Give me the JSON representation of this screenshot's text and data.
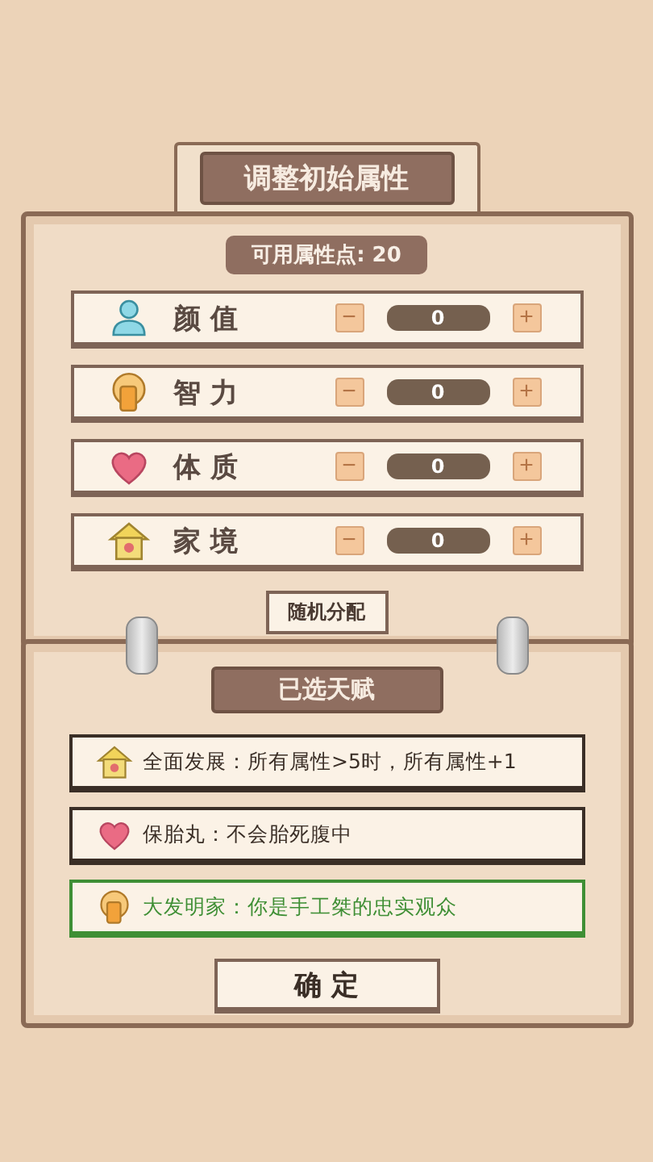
{
  "title": "调整初始属性",
  "points_label": "可用属性点: 20",
  "attributes": [
    {
      "kind": "person",
      "name": "颜 值",
      "minus": "−",
      "value": "0",
      "plus": "+"
    },
    {
      "kind": "brain",
      "name": "智 力",
      "minus": "−",
      "value": "0",
      "plus": "+"
    },
    {
      "kind": "heart",
      "name": "体 质",
      "minus": "−",
      "value": "0",
      "plus": "+"
    },
    {
      "kind": "house",
      "name": "家 境",
      "minus": "−",
      "value": "0",
      "plus": "+"
    }
  ],
  "random_button": "随机分配",
  "talents_title": "已选天赋",
  "talents": [
    {
      "kind": "house",
      "text": "全面发展：所有属性>5时，所有属性+1",
      "color": "#3a2e26"
    },
    {
      "kind": "heart",
      "text": "保胎丸：不会胎死腹中",
      "color": "#3a2e26"
    },
    {
      "kind": "brain",
      "text": "大发明家：你是手工桀的忠实观众",
      "color": "#3f8f35"
    }
  ],
  "confirm_button": "确 定"
}
